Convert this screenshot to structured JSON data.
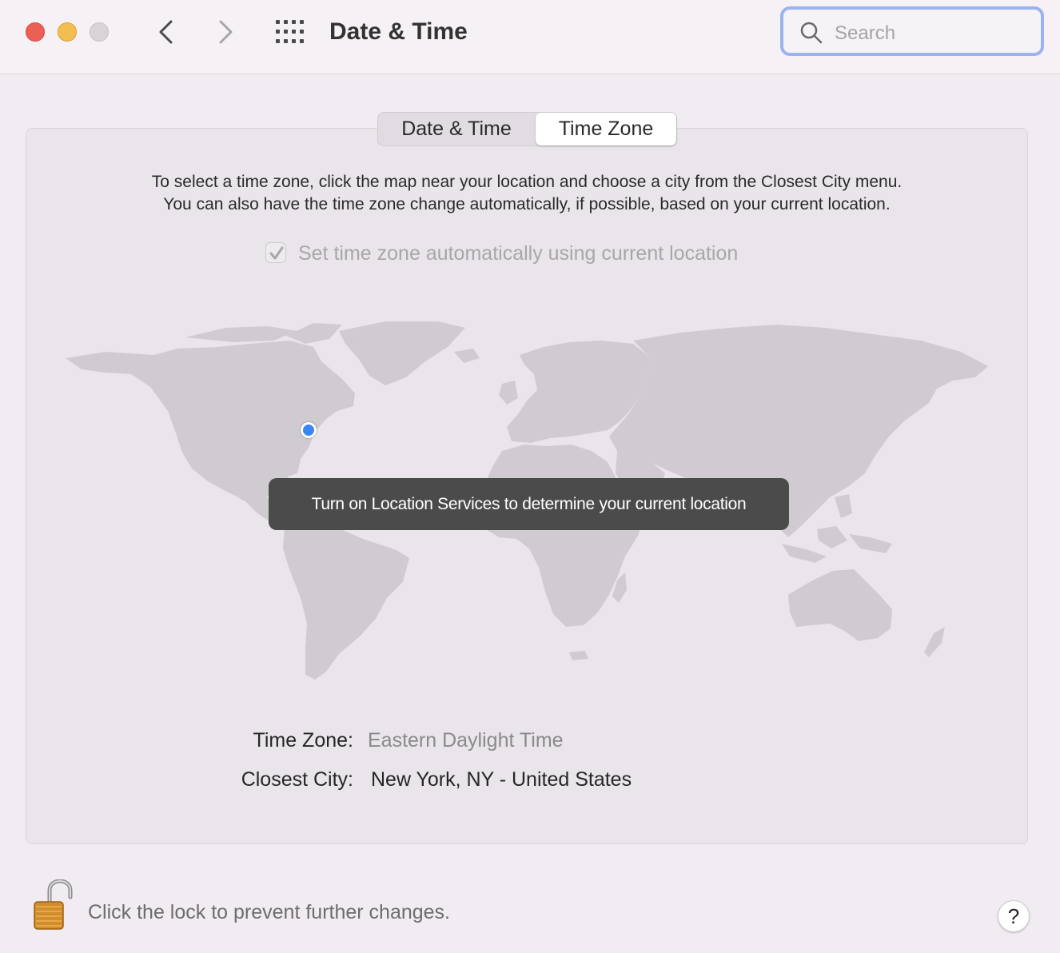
{
  "window": {
    "title": "Date & Time",
    "traffic_lights": {
      "close": "#ec5f57",
      "minimize": "#f4bd4f",
      "zoom": "#d8d4d8"
    }
  },
  "toolbar": {
    "back_icon": "chevron-left-icon",
    "forward_icon": "chevron-right-icon",
    "grid_icon": "grid-icon",
    "search": {
      "placeholder": "Search",
      "value": ""
    }
  },
  "tabs": [
    {
      "label": "Date & Time",
      "selected": false
    },
    {
      "label": "Time Zone",
      "selected": true
    }
  ],
  "time_zone": {
    "description_line1": "To select a time zone, click the map near your location and choose a city from the Closest City menu.",
    "description_line2": "You can also have the time zone change automatically, if possible, based on your current location.",
    "auto_checkbox_label": "Set time zone automatically using current location",
    "auto_checkbox_checked": true,
    "auto_checkbox_disabled": true,
    "location_notice": "Turn on Location Services to determine your current location",
    "time_zone_label": "Time Zone:",
    "time_zone_value": "Eastern Daylight Time",
    "closest_city_label": "Closest City:",
    "closest_city_value": "New York, NY - United States"
  },
  "footer": {
    "lock_text": "Click the lock to prevent further changes.",
    "lock_icon": "unlocked-padlock-icon",
    "help_label": "?"
  },
  "colors": {
    "accent_focus_ring": "#9bb3ee",
    "location_dot": "#3b86f7",
    "map_land": "#cfcbd0",
    "notice_background": "#4c4b4c"
  }
}
